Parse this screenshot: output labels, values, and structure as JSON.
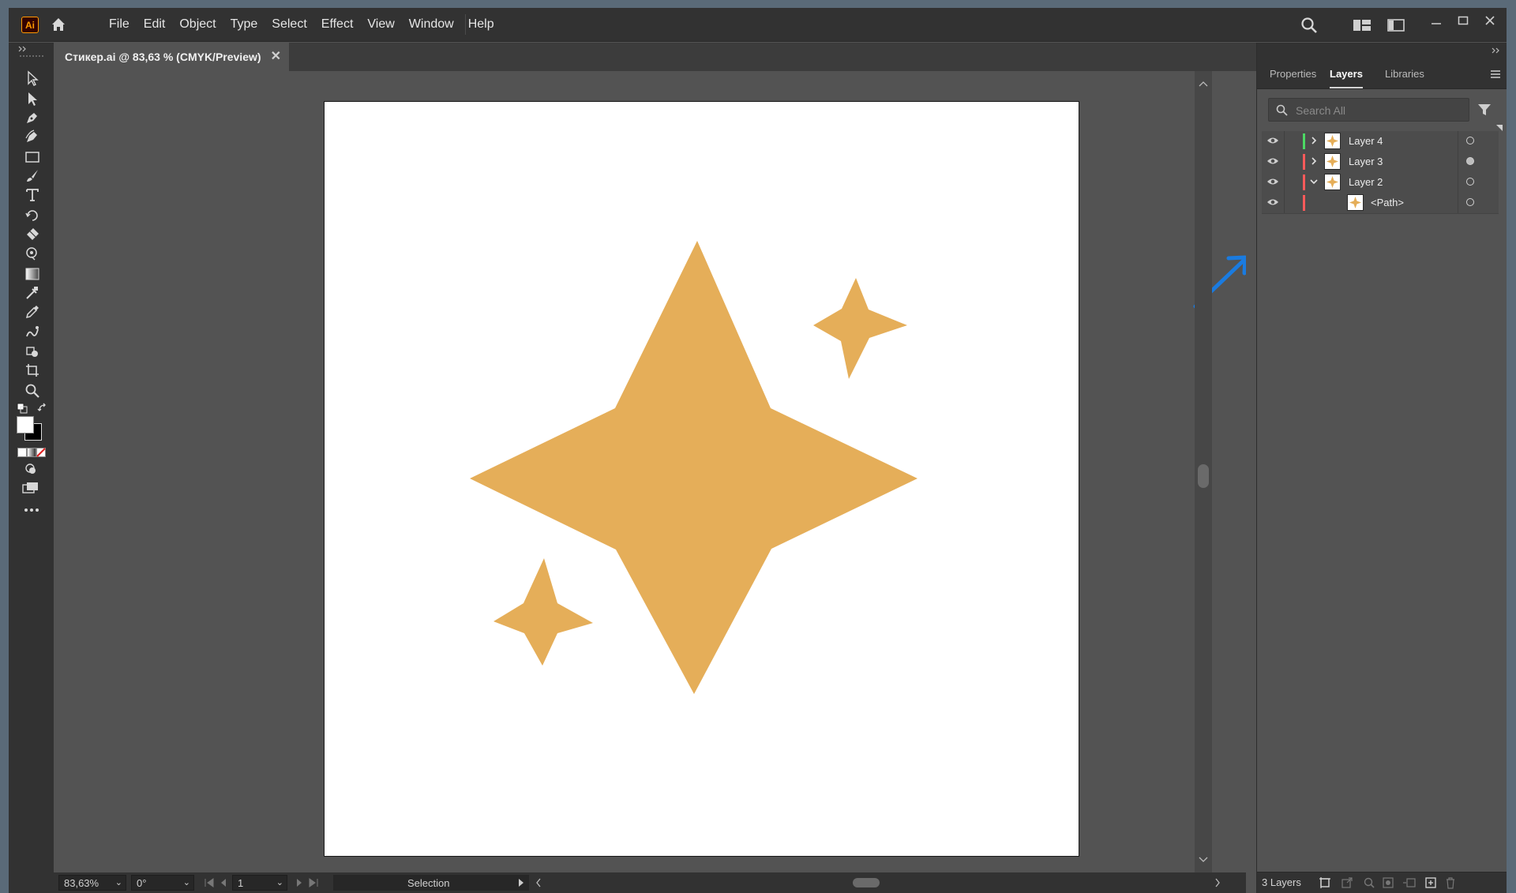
{
  "app": {
    "logo_text": "Ai",
    "menu": [
      "File",
      "Edit",
      "Object",
      "Type",
      "Select",
      "Effect",
      "View",
      "Window",
      "Help"
    ]
  },
  "document": {
    "tab_title": "Стикер.ai @ 83,63 % (CMYK/Preview)",
    "close_symbol": "✕"
  },
  "status": {
    "zoom": "83,63%",
    "rotation": "0°",
    "artboard_number": "1",
    "current_tool": "Selection"
  },
  "panel": {
    "tabs": [
      "Properties",
      "Layers",
      "Libraries"
    ],
    "active_tab": "Layers",
    "search_placeholder": "Search All",
    "layers": [
      {
        "name": "Layer 4",
        "color": "#4cd964",
        "expanded": false
      },
      {
        "name": "Layer 3",
        "color": "#ff5a5a",
        "expanded": false
      },
      {
        "name": "Layer 2",
        "color": "#ff5a5a",
        "expanded": true
      }
    ],
    "sublayer": {
      "name": "<Path>",
      "color": "#ff5a5a"
    },
    "footer_count": "3 Layers"
  },
  "colors": {
    "sparkle_fill": "#e5ae59",
    "annotation_arrow": "#1a7be0",
    "ui_dark": "#323232",
    "ui_mid": "#535353"
  },
  "icons": [
    "home-icon",
    "search-icon",
    "workspace-icon",
    "arrange-documents-icon",
    "minimize-icon",
    "maximize-icon",
    "close-icon",
    "eye-icon",
    "filter-icon",
    "panel-menu-icon"
  ]
}
